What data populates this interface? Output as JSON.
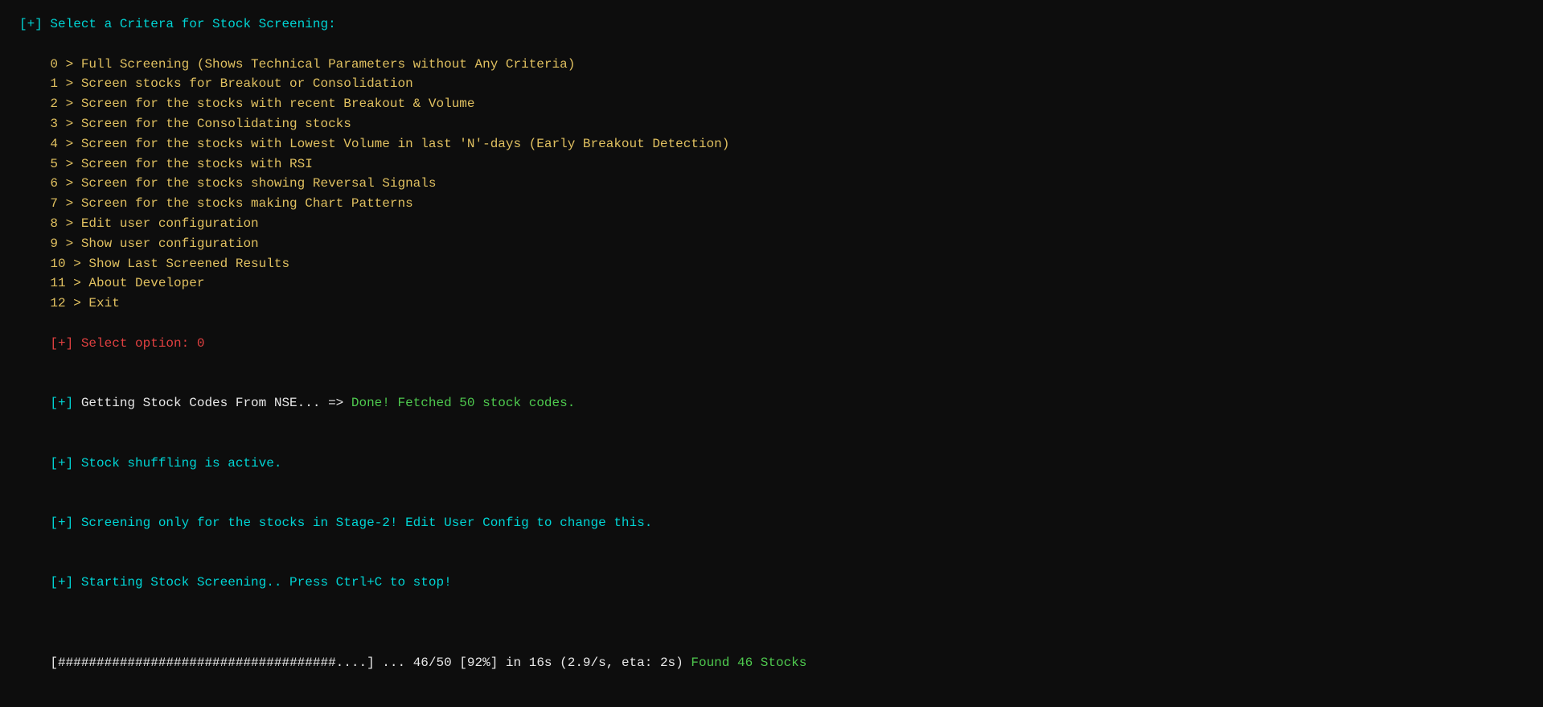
{
  "terminal": {
    "header": "[+] Select a Critera for Stock Screening:",
    "menu_items": [
      {
        "key": "0",
        "label": "Full Screening (Shows Technical Parameters without Any Criteria)"
      },
      {
        "key": "1",
        "label": "Screen stocks for Breakout or Consolidation"
      },
      {
        "key": "2",
        "label": "Screen for the stocks with recent Breakout & Volume"
      },
      {
        "key": "3",
        "label": "Screen for the Consolidating stocks"
      },
      {
        "key": "4",
        "label": "Screen for the stocks with Lowest Volume in last 'N'-days (Early Breakout Detection)"
      },
      {
        "key": "5",
        "label": "Screen for the stocks with RSI"
      },
      {
        "key": "6",
        "label": "Screen for the stocks showing Reversal Signals"
      },
      {
        "key": "7",
        "label": "Screen for the stocks making Chart Patterns"
      },
      {
        "key": "8",
        "label": "Edit user configuration"
      },
      {
        "key": "9",
        "label": "Show user configuration"
      },
      {
        "key": "10",
        "label": "Show Last Screened Results"
      },
      {
        "key": "11",
        "label": "About Developer"
      },
      {
        "key": "12",
        "label": "Exit"
      }
    ],
    "select_option_prefix": "[+] Select option: ",
    "select_option_value": "0",
    "status_lines": [
      {
        "prefix": "[+] ",
        "text_white": "Getting Stock Codes From NSE... ",
        "text_arrow": "=> ",
        "text_green": "Done! Fetched 50 stock codes."
      }
    ],
    "shuffle_line": "[+] Stock shuffling is active.",
    "stage_line": "[+] Screening only for the stocks in Stage-2! Edit User Config to change this.",
    "start_line": "[+] Starting Stock Screening.. Press Ctrl+C to stop!",
    "progress": {
      "bar_filled": "####################################",
      "bar_empty": "....",
      "stats": " ... 46/50 [92%] in 16s (2.9/s, eta: 2s) ",
      "found": "Found 46 Stocks"
    }
  }
}
